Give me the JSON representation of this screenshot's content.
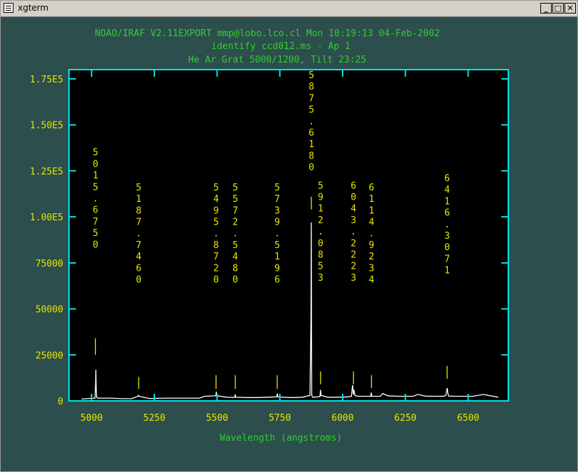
{
  "window": {
    "title": "xgterm",
    "minimize_glyph": "_",
    "maximize_glyph": "□",
    "close_glyph": "✕",
    "icon": "terminal-menu-icon"
  },
  "header": {
    "line1": "NOAO/IRAF V2.11EXPORT mmp@lobo.lco.cl Mon 10:19:13 04-Feb-2002",
    "line2": "identify ccd012.ms - Ap 1",
    "line3": "He Ar Grat 5000/1200, Tilt 23:25"
  },
  "colors": {
    "header": "#32cd32",
    "axes": "#00e5e5",
    "ticklabels": "#e6e600",
    "spectrum": "#ffffff",
    "annotations": "#e6e600",
    "plot_bg": "#000000",
    "xlabel": "#32cd32"
  },
  "chart_data": {
    "type": "line",
    "xlabel": "Wavelength (angstroms)",
    "ylabel": "",
    "xlim": [
      4910,
      6660
    ],
    "ylim": [
      0,
      180000
    ],
    "xticks": [
      5000,
      5250,
      5500,
      5750,
      6000,
      6250,
      6500
    ],
    "yticks": [
      0,
      25000,
      50000,
      75000,
      100000,
      125000,
      150000,
      175000
    ],
    "xticklabels": [
      "5000",
      "5250",
      "5500",
      "5750",
      "6000",
      "6250",
      "6500"
    ],
    "yticklabels": [
      "0",
      "25000",
      "50000",
      "75000",
      "1.00E5",
      "1.25E5",
      "1.50E5",
      "1.75E5"
    ],
    "series": [
      {
        "x": [
          4960,
          5010,
          5014,
          5016,
          5017,
          5018,
          5020,
          5024,
          5030,
          5080,
          5120,
          5160,
          5185,
          5187,
          5189,
          5230,
          5300,
          5380,
          5430,
          5450,
          5495,
          5497,
          5499,
          5540,
          5570,
          5572,
          5574,
          5620,
          5660,
          5700,
          5737,
          5740,
          5742,
          5790,
          5840,
          5870,
          5874,
          5875,
          5876,
          5877,
          5881,
          5900,
          5910,
          5912,
          5914,
          5940,
          5980,
          6020,
          6035,
          6039,
          6040,
          6041,
          6043,
          6045,
          6049,
          6060,
          6100,
          6112,
          6114,
          6116,
          6150,
          6160,
          6180,
          6220,
          6280,
          6300,
          6330,
          6380,
          6405,
          6411,
          6415,
          6417,
          6419,
          6423,
          6450,
          6520,
          6560,
          6620
        ],
        "y": [
          1000,
          1500,
          1500,
          9000,
          17000,
          9000,
          2000,
          1500,
          1500,
          1500,
          1200,
          1200,
          2600,
          3000,
          2500,
          1300,
          1500,
          1500,
          1500,
          2500,
          2800,
          5000,
          2800,
          2000,
          1900,
          3500,
          2000,
          1800,
          1800,
          2000,
          2200,
          4000,
          2200,
          1800,
          2000,
          3000,
          45000,
          97000,
          45000,
          3000,
          2000,
          2200,
          2400,
          6000,
          3000,
          2000,
          2000,
          2200,
          2500,
          8000,
          8500,
          6500,
          3500,
          6000,
          3000,
          2500,
          2500,
          2500,
          4500,
          2500,
          2500,
          4000,
          2800,
          2500,
          2500,
          3500,
          2600,
          2500,
          2600,
          3000,
          6000,
          7000,
          4000,
          2600,
          2500,
          2500,
          3500,
          2000
        ]
      }
    ],
    "lines": [
      {
        "label": "5015.6750",
        "x": 5015.675,
        "y_top": 34000,
        "y_bottom": 25000,
        "text_top": 138000
      },
      {
        "label": "5187.7460",
        "x": 5187.746,
        "y_top": 13000,
        "y_bottom": 6500,
        "text_top": 119000
      },
      {
        "label": "5495.8720",
        "x": 5495.872,
        "y_top": 14000,
        "y_bottom": 6500,
        "text_top": 119000
      },
      {
        "label": "5572.5480",
        "x": 5572.548,
        "y_top": 14000,
        "y_bottom": 6500,
        "text_top": 119000
      },
      {
        "label": "5739.5196",
        "x": 5739.5196,
        "y_top": 14000,
        "y_bottom": 6500,
        "text_top": 119000
      },
      {
        "label": "5875.6180",
        "x": 5875.618,
        "y_top": 111000,
        "y_bottom": 104000,
        "text_top": 180000
      },
      {
        "label": "5912.0853",
        "x": 5912.0853,
        "y_top": 16000,
        "y_bottom": 9000,
        "text_top": 120000
      },
      {
        "label": "6043.2223",
        "x": 6043.2223,
        "y_top": 16000,
        "y_bottom": 9000,
        "text_top": 120000
      },
      {
        "label": "6114.9234",
        "x": 6114.9234,
        "y_top": 14000,
        "y_bottom": 7000,
        "text_top": 119000
      },
      {
        "label": "6416.3071",
        "x": 6416.3071,
        "y_top": 19000,
        "y_bottom": 12000,
        "text_top": 124000
      }
    ]
  }
}
